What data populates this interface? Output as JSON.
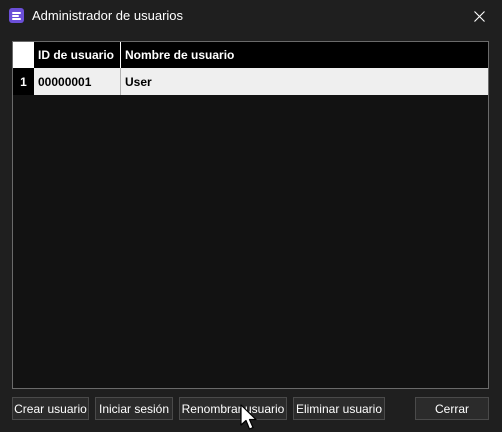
{
  "window": {
    "title": "Administrador de usuarios",
    "accent_color": "#6b4fd8"
  },
  "table": {
    "columns": [
      "ID de usuario",
      "Nombre de usuario"
    ],
    "rows": [
      {
        "row_number": "1",
        "id": "00000001",
        "name": "User"
      }
    ]
  },
  "buttons": {
    "create": "Crear usuario",
    "login": "Iniciar sesión",
    "rename": "Renombrar usuario",
    "delete": "Eliminar usuario",
    "close": "Cerrar"
  },
  "icons": {
    "app": "app-logo-icon",
    "close": "close-icon",
    "cursor": "mouse-pointer-icon"
  }
}
